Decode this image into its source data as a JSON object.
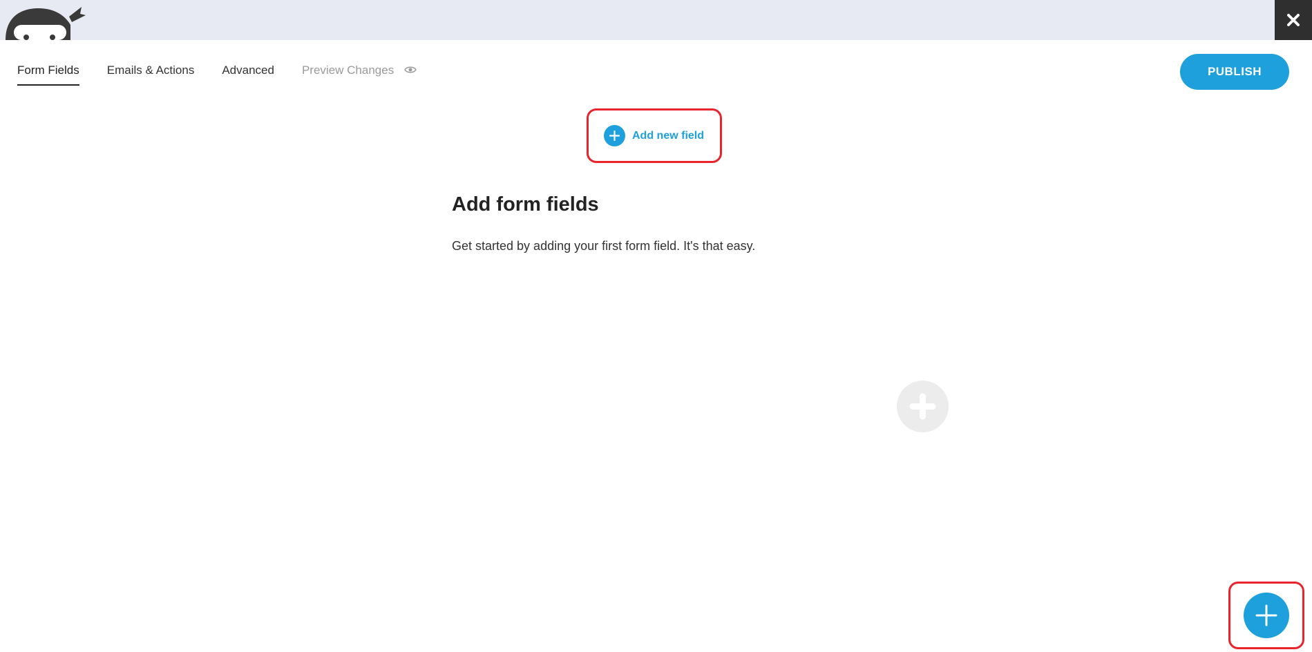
{
  "header": {
    "logo_icon": "ninja-logo-icon",
    "close_icon": "close-icon"
  },
  "tabs": [
    {
      "label": "Form Fields",
      "active": true
    },
    {
      "label": "Emails & Actions",
      "active": false
    },
    {
      "label": "Advanced",
      "active": false
    },
    {
      "label": "Preview Changes",
      "active": false,
      "disabled": true,
      "icon": "eye-icon"
    }
  ],
  "publish": {
    "label": "PUBLISH"
  },
  "main": {
    "add_field_label": "Add new field",
    "heading": "Add form fields",
    "subtext": "Get started by adding your first form field. It's that easy."
  },
  "colors": {
    "accent": "#1ea0dc",
    "highlight": "#e8232b",
    "topbar": "#e8eaf3",
    "close_bg": "#2f2f2f"
  }
}
